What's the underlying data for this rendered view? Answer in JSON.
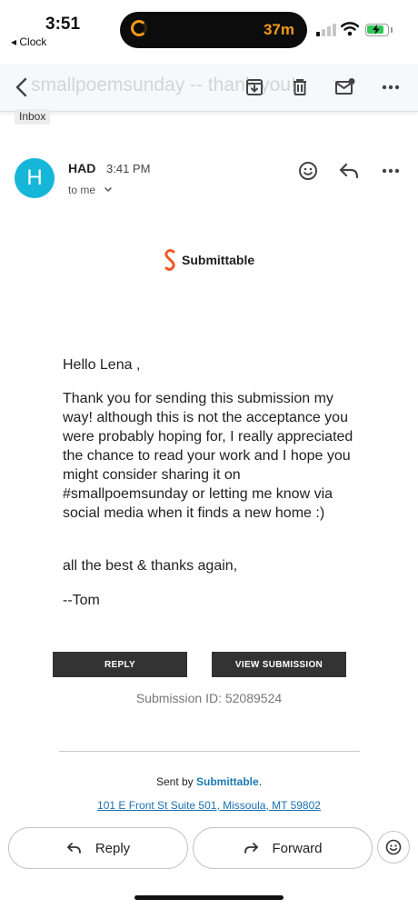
{
  "status_bar": {
    "time": "3:51",
    "back_app": "◂ Clock",
    "island_timer": "37m"
  },
  "toolbar": {
    "subject_ghost": "smallpoemsunday -- thank you!"
  },
  "labels": {
    "inbox": "Inbox"
  },
  "message": {
    "avatar_letter": "H",
    "sender": "HAD",
    "time": "3:41 PM",
    "recipient": "to me"
  },
  "email": {
    "logo_text": "Submittable",
    "greeting": "Hello Lena ,",
    "paragraph": "Thank you for sending this submission my way! although this is not the acceptance you were probably hoping for, I really appreciated the chance to read your work and I hope you might consider sharing it on #smallpoemsunday or letting me know via social media when it finds a new home :)",
    "closing": "all the best & thanks again,",
    "signature": "--Tom",
    "reply_button": "REPLY",
    "view_button": "VIEW SUBMISSION",
    "submission_id": "Submission ID: 52089524",
    "sent_by_prefix": "Sent by",
    "sent_by_brand": "Submittable",
    "sent_by_suffix": ".",
    "address": "101 E Front St Suite 501, Missoula, MT 59802"
  },
  "actions": {
    "reply": "Reply",
    "forward": "Forward"
  },
  "colors": {
    "avatar": "#16b6d9",
    "logo": "#f05a28",
    "link": "#1b79b2"
  }
}
